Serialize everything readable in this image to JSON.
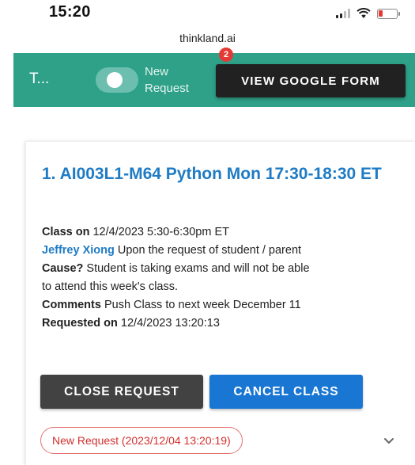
{
  "status_bar": {
    "time": "15:20"
  },
  "browser": {
    "url": "thinkland.ai"
  },
  "header": {
    "title": "T...",
    "new_request_line1": "New",
    "new_request_line2": "Request",
    "badge_count": "2",
    "google_form_label": "VIEW GOOGLE FORM",
    "accent_color": "#2fa189"
  },
  "request": {
    "title": "1. AI003L1-M64 Python Mon 17:30-18:30 ET",
    "class_on_label": "Class on",
    "class_on_value": "12/4/2023 5:30-6:30pm ET",
    "requester_name": "Jeffrey Xiong",
    "requester_note": "Upon the request of student / parent",
    "cause_label": "Cause?",
    "cause_line1": "Student is taking exams and will not be able",
    "cause_line2": "to attend this week's class.",
    "comments_label": "Comments",
    "comments_value": "Push Class to next week December 11",
    "requested_on_label": "Requested on",
    "requested_on_value": "12/4/2023 13:20:13",
    "close_label": "CLOSE REQUEST",
    "cancel_label": "CANCEL CLASS",
    "status_chip": "New Request (2023/12/04 13:20:19)"
  }
}
